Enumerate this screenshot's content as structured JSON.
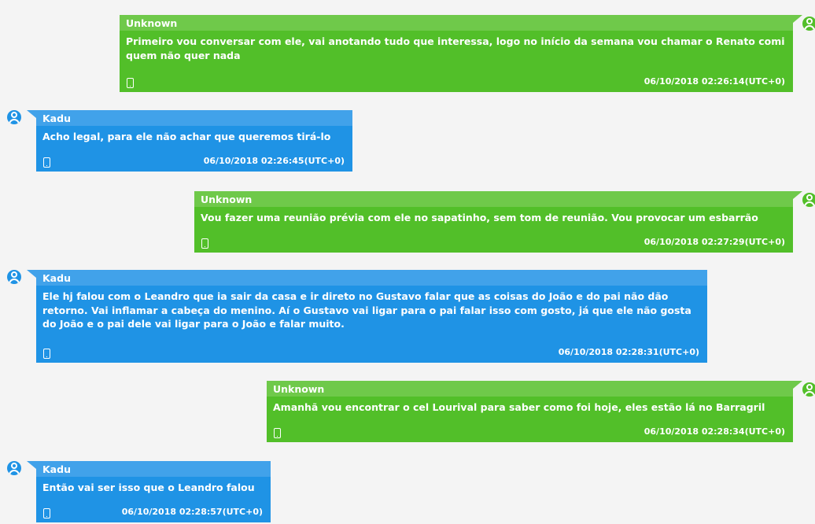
{
  "colors": {
    "background": "#f4f4f4",
    "incoming_bubble": "#1f93e5",
    "incoming_header": "#41a2ea",
    "outgoing_bubble": "#52bf29",
    "outgoing_header": "#6fc94a",
    "text": "#ffffff"
  },
  "icons": {
    "avatar": "user-avatar-icon",
    "device": "phone-device-icon"
  },
  "messages": [
    {
      "direction": "outgoing",
      "sender": "Unknown",
      "text": "Primeiro vou conversar com ele, vai anotando tudo que interessa, logo no início da semana vou chamar o Renato comi quem não quer nada",
      "timestamp": "06/10/2018 02:26:14(UTC+0)"
    },
    {
      "direction": "incoming",
      "sender": "Kadu",
      "text": "Acho legal, para ele não achar que queremos tirá-lo",
      "timestamp": "06/10/2018 02:26:45(UTC+0)"
    },
    {
      "direction": "outgoing",
      "sender": "Unknown",
      "text": "Vou fazer uma reunião prévia com ele no sapatinho, sem tom de reunião. Vou provocar um esbarrão",
      "timestamp": "06/10/2018 02:27:29(UTC+0)"
    },
    {
      "direction": "incoming",
      "sender": "Kadu",
      "text": "Ele hj falou com o Leandro que ia sair da casa e ir direto no Gustavo falar que as coisas do João e do pai não dão retorno. Vai inflamar a cabeça do menino. Aí o Gustavo vai ligar para o pai falar isso com gosto, já que ele não gosta do João e o pai dele vai ligar para o João e falar muito.",
      "timestamp": "06/10/2018 02:28:31(UTC+0)"
    },
    {
      "direction": "outgoing",
      "sender": "Unknown",
      "text": "Amanhã vou encontrar o cel Lourival para saber como foi hoje, eles estão lá no Barragril",
      "timestamp": "06/10/2018 02:28:34(UTC+0)"
    },
    {
      "direction": "incoming",
      "sender": "Kadu",
      "text": "Então vai ser isso que o Leandro falou",
      "timestamp": "06/10/2018 02:28:57(UTC+0)"
    }
  ]
}
